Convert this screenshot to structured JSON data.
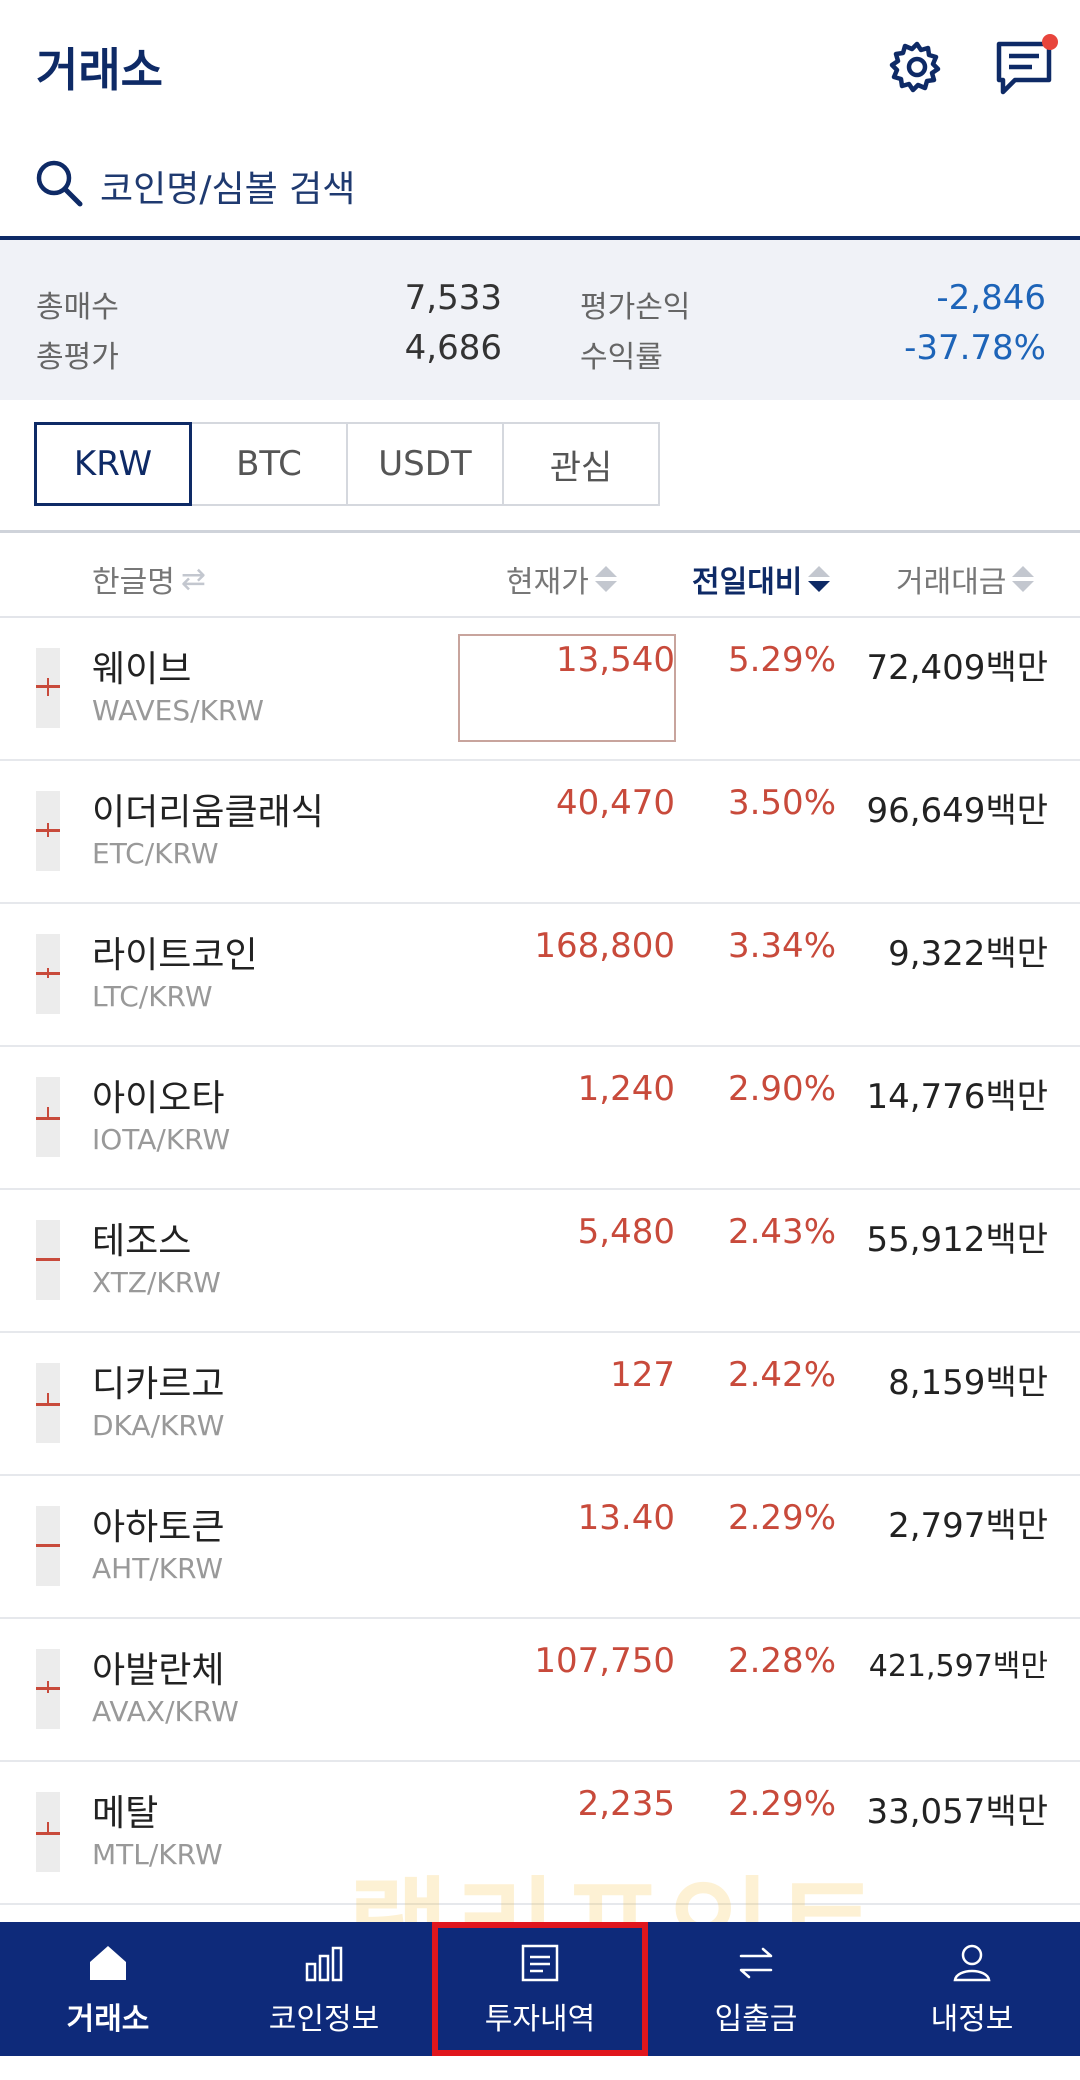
{
  "header": {
    "title": "거래소",
    "settings_icon": "gear-icon",
    "messages_icon": "chat-icon",
    "accent_color": "#0e2a66",
    "notification_color": "#e8453c"
  },
  "search": {
    "placeholder": "코인명/심볼 검색"
  },
  "summary": {
    "total_buy_label": "총매수",
    "total_buy_value": "7,533",
    "total_eval_label": "총평가",
    "total_eval_value": "4,686",
    "pnl_label": "평가손익",
    "pnl_value": "-2,846",
    "return_label": "수익률",
    "return_value": "-37.78%"
  },
  "market_tabs": [
    {
      "label": "KRW",
      "active": true
    },
    {
      "label": "BTC",
      "active": false
    },
    {
      "label": "USDT",
      "active": false
    },
    {
      "label": "관심",
      "active": false
    }
  ],
  "columns": {
    "name": "한글명",
    "price": "현재가",
    "change": "전일대비",
    "volume": "거래대금"
  },
  "rows": [
    {
      "name": "웨이브",
      "symbol": "WAVES/KRW",
      "price": "13,540",
      "change": "5.29%",
      "volume": "72,409",
      "unit": "백만"
    },
    {
      "name": "이더리움클래식",
      "symbol": "ETC/KRW",
      "price": "40,470",
      "change": "3.50%",
      "volume": "96,649",
      "unit": "백만"
    },
    {
      "name": "라이트코인",
      "symbol": "LTC/KRW",
      "price": "168,800",
      "change": "3.34%",
      "volume": "9,322",
      "unit": "백만"
    },
    {
      "name": "아이오타",
      "symbol": "IOTA/KRW",
      "price": "1,240",
      "change": "2.90%",
      "volume": "14,776",
      "unit": "백만"
    },
    {
      "name": "테조스",
      "symbol": "XTZ/KRW",
      "price": "5,480",
      "change": "2.43%",
      "volume": "55,912",
      "unit": "백만"
    },
    {
      "name": "디카르고",
      "symbol": "DKA/KRW",
      "price": "127",
      "change": "2.42%",
      "volume": "8,159",
      "unit": "백만"
    },
    {
      "name": "아하토큰",
      "symbol": "AHT/KRW",
      "price": "13.40",
      "change": "2.29%",
      "volume": "2,797",
      "unit": "백만"
    },
    {
      "name": "아발란체",
      "symbol": "AVAX/KRW",
      "price": "107,750",
      "change": "2.28%",
      "volume": "421,597",
      "unit": "백만"
    },
    {
      "name": "메탈",
      "symbol": "MTL/KRW",
      "price": "2,235",
      "change": "2.29%",
      "volume": "33,057",
      "unit": "백만"
    }
  ],
  "watermark": "랠리포인트",
  "bottom_nav": [
    {
      "label": "거래소",
      "icon": "home-icon",
      "active": true
    },
    {
      "label": "코인정보",
      "icon": "bar-chart-icon",
      "active": false
    },
    {
      "label": "투자내역",
      "icon": "document-icon",
      "active": false
    },
    {
      "label": "입출금",
      "icon": "transfer-icon",
      "active": false
    },
    {
      "label": "내정보",
      "icon": "user-icon",
      "active": false
    }
  ],
  "colors": {
    "up": "#c84a3b",
    "down": "#1d64b8",
    "nav_bg": "#0e2a7a",
    "highlight_box": "#e0161d"
  }
}
